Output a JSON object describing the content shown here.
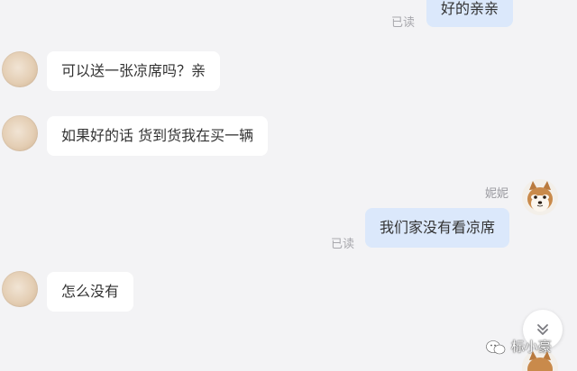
{
  "messages": [
    {
      "sender": "self",
      "text": "好的亲亲",
      "read_label": "已读"
    },
    {
      "sender": "contact",
      "text": "可以送一张凉席吗？亲"
    },
    {
      "sender": "contact",
      "text": "如果好的话 货到货我在买一辆"
    },
    {
      "sender": "self",
      "name": "妮妮",
      "text": "我们家没有看凉席",
      "read_label": "已读"
    },
    {
      "sender": "contact",
      "text": "怎么没有"
    }
  ],
  "watermark": {
    "text": "标小豪"
  },
  "icons": {
    "contact_avatar": "person-avatar",
    "self_avatar": "shiba-dog-avatar",
    "scroll_down": "chevron-double-down-icon",
    "watermark_logo": "wechat-logo-icon"
  },
  "colors": {
    "background": "#f3f3f5",
    "incoming_bubble": "#ffffff",
    "outgoing_bubble": "#dbe8fb",
    "read_text": "#a8a8ad",
    "message_text": "#333333"
  }
}
